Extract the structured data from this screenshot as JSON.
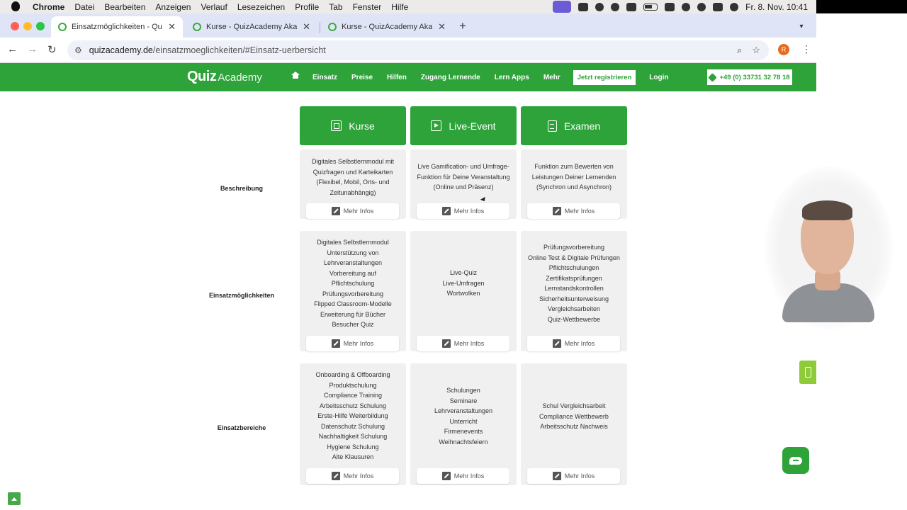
{
  "menubar": {
    "app": "Chrome",
    "items": [
      "Datei",
      "Bearbeiten",
      "Anzeigen",
      "Verlauf",
      "Lesezeichen",
      "Profile",
      "Tab",
      "Fenster",
      "Hilfe"
    ],
    "clock": "Fr. 8. Nov.  10:41"
  },
  "tabs": [
    {
      "label": "Einsatzmöglichkeiten - QuizAcademy"
    },
    {
      "label": "Kurse - QuizAcademy Akademie"
    },
    {
      "label": "Kurse - QuizAcademy Akademie"
    }
  ],
  "address": {
    "host": "quizacademy.de",
    "path": "/einsatzmoeglichkeiten/#Einsatz-uerbersicht",
    "profile_initial": "R"
  },
  "site": {
    "logo_quiz": "Quiz",
    "logo_academy": "Academy",
    "nav": [
      "Einsatz",
      "Preise",
      "Hilfen",
      "Zugang Lernende",
      "Lern Apps",
      "Mehr"
    ],
    "register": "Jetzt registrieren",
    "login": "Login",
    "phone": "+49 (0) 33731 32 78 18"
  },
  "table": {
    "columns": [
      "Kurse",
      "Live-Event",
      "Examen"
    ],
    "more_label": "Mehr Infos",
    "rows": [
      {
        "label": "Beschreibung",
        "cells": [
          "Digitales Selbstlernmodul mit Quizfragen und Karteikarten (Flexibel, Mobil, Orts- und Zeitunabhängig)",
          "Live Gamification- und Umfrage-Funktion für Deine Veranstaltung (Online und Präsenz)",
          "Funktion zum Bewerten von Leistungen Deiner Lernenden (Synchron und Asynchron)"
        ]
      },
      {
        "label": "Einsatzmöglichkeiten",
        "cells": [
          "Digitales Selbstlernmodul\nUnterstützung von\nLehrveranstaltungen\nVorbereitung auf\nPflichtschulung\nPrüfungsvorbereitung\nFlipped Classroom-Modelle\nErweiterung für Bücher\nBesucher Quiz",
          "Live-Quiz\nLive-Umfragen\nWortwolken",
          "Prüfungsvorbereitung\nOnline Test & Digitale Prüfungen\nPflichtschulungen\nZertifikatsprüfungen\nLernstandskontrollen\nSicherheitsunterweisung\nVergleichsarbeiten\nQuiz-Wettbewerbe"
        ]
      },
      {
        "label": "Einsatzbereiche",
        "cells": [
          "Onboarding & Offboarding\nProduktschulung\nCompliance Training\nArbeitsschutz Schulung\nErste-Hilfe Weiterbildung\nDatenschutz Schulung\nNachhaltigkeit Schulung\nHygiene Schulung\nAlte Klausuren",
          "Schulungen\nSeminare\nLehrveranstaltungen\nUnterricht\nFirmenevents\nWeihnachtsfeiern",
          "Schul Vergleichsarbeit\nCompliance Wettbewerb\nArbeitsschutz Nachweis"
        ]
      }
    ]
  },
  "colors": {
    "brand_green": "#2ea33a",
    "cell_bg": "#f0f0f0",
    "tabbar": "#dfe5f7"
  }
}
